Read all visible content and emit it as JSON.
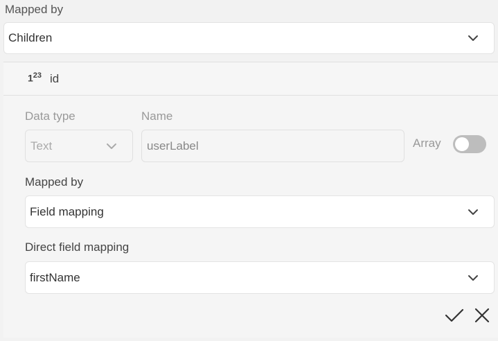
{
  "top": {
    "label": "Mapped by",
    "select_value": "Children",
    "chevron_icon": "chevron-down-icon"
  },
  "field": {
    "type_icon": "number-type-icon",
    "type_icon_main": "1",
    "type_icon_sup": "2",
    "type_icon_sup2": "3",
    "id_label": "id"
  },
  "form": {
    "data_type_label": "Data type",
    "data_type_value": "Text",
    "name_label": "Name",
    "name_value": "userLabel",
    "array_label": "Array",
    "array_enabled": false,
    "mapped_by_label": "Mapped by",
    "mapped_by_value": "Field mapping",
    "direct_label": "Direct field mapping",
    "direct_value": "firstName"
  },
  "actions": {
    "confirm_icon": "check-icon",
    "cancel_icon": "close-icon"
  }
}
